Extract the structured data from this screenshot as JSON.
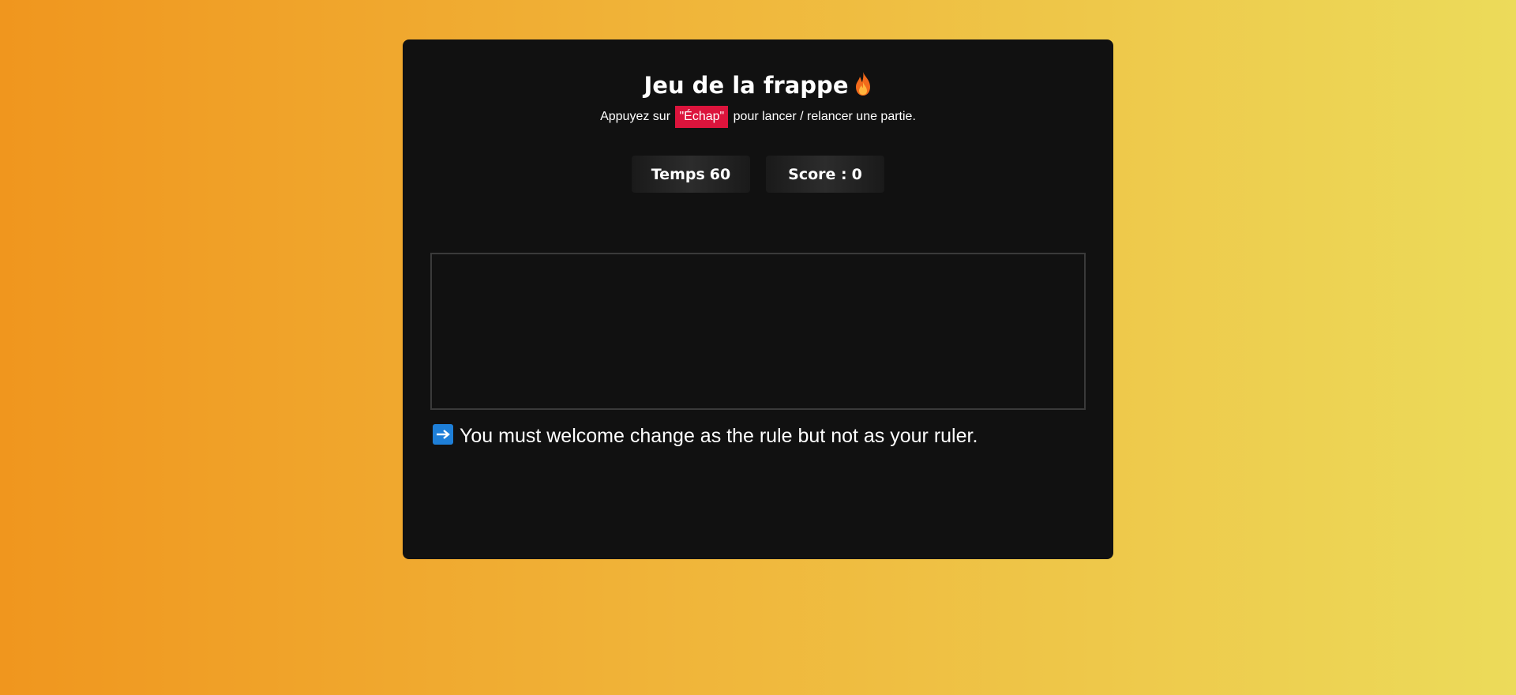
{
  "game": {
    "title": "Jeu de la frappe",
    "title_icon": "fire-icon",
    "instruction_before": "Appuyez sur",
    "instruction_key": "\"Échap\"",
    "instruction_after": "pour lancer / relancer une partie.",
    "accent_color": "#dc143c"
  },
  "stats": {
    "time_label": "Temps",
    "time_value": "60",
    "score_label": "Score :",
    "score_value": "0"
  },
  "quote": {
    "icon": "right-arrow-icon",
    "icon_color": "#1e7fd8",
    "text": "You must welcome change as the rule but not as your ruler."
  }
}
